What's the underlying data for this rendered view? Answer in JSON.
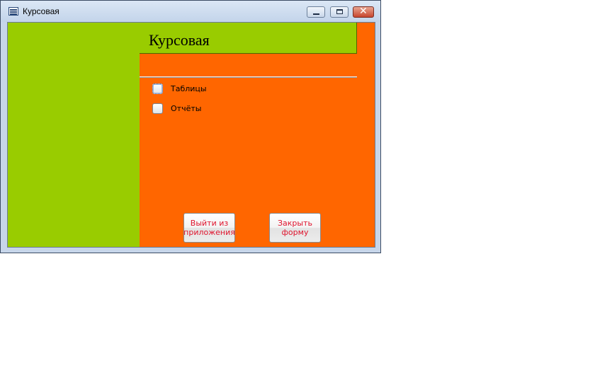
{
  "window": {
    "title": "Курсовая",
    "app_icon": "form-icon",
    "controls": {
      "minimize": "minimize-icon",
      "maximize": "maximize-icon",
      "close": "close-icon",
      "close_glyph": "✕"
    }
  },
  "form": {
    "header_title": "Курсовая",
    "items": [
      {
        "label": "Таблицы"
      },
      {
        "label": "Отчёты"
      }
    ],
    "buttons": {
      "exit_label": "Выйти из приложения",
      "close_label": "Закрыть форму"
    },
    "colors": {
      "green": "#99cc00",
      "orange": "#ff6600",
      "button_text": "#e0142e"
    }
  }
}
